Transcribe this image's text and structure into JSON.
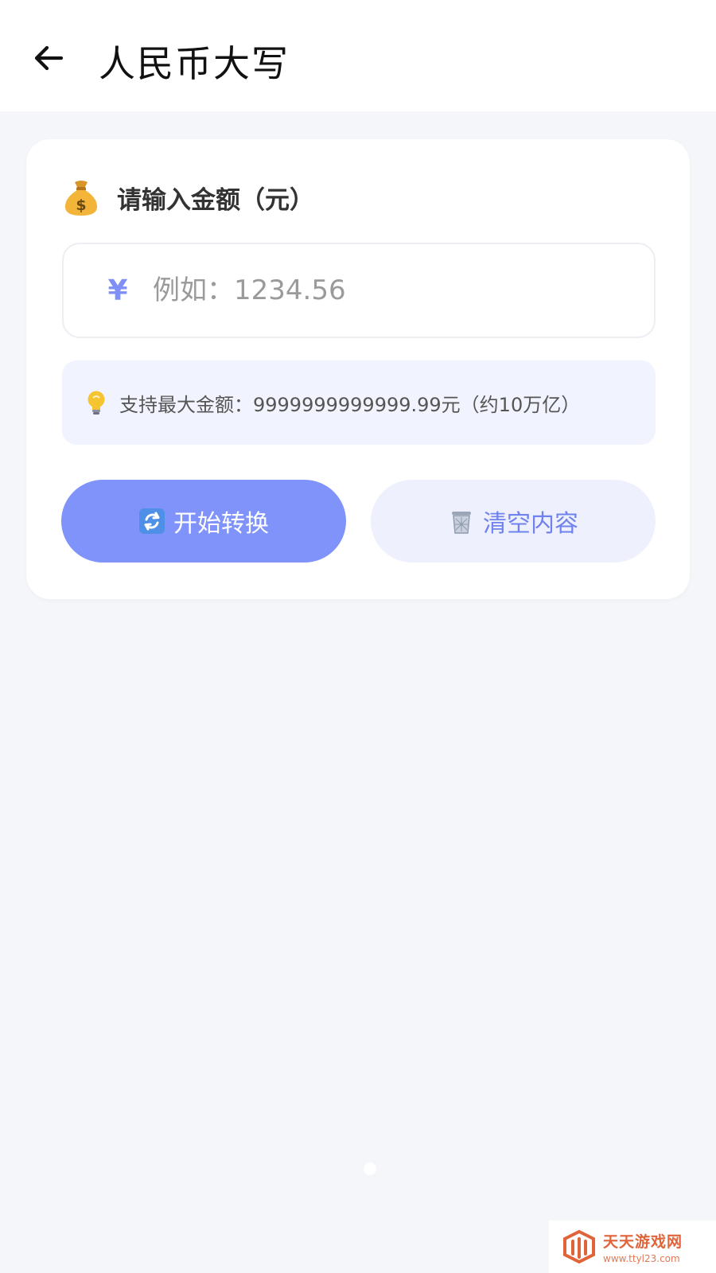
{
  "header": {
    "title": "人民币大写",
    "back_icon": "arrow-left-icon"
  },
  "card": {
    "label": "请输入金额（元）",
    "label_icon": "money-bag-icon",
    "input": {
      "currency_symbol": "¥",
      "value": "",
      "placeholder": "例如：1234.56"
    },
    "tip": {
      "icon": "lightbulb-icon",
      "text": "支持最大金额：9999999999999.99元（约10万亿）"
    },
    "buttons": {
      "convert_label": "开始转换",
      "convert_icon": "refresh-icon",
      "clear_label": "清空内容",
      "clear_icon": "trash-icon"
    }
  },
  "watermark": {
    "name": "天天游戏网",
    "url": "www.ttyl23.com"
  },
  "colors": {
    "accent": "#7f93fb",
    "accent_light": "#eef1fd",
    "background": "#f4f6fa"
  }
}
